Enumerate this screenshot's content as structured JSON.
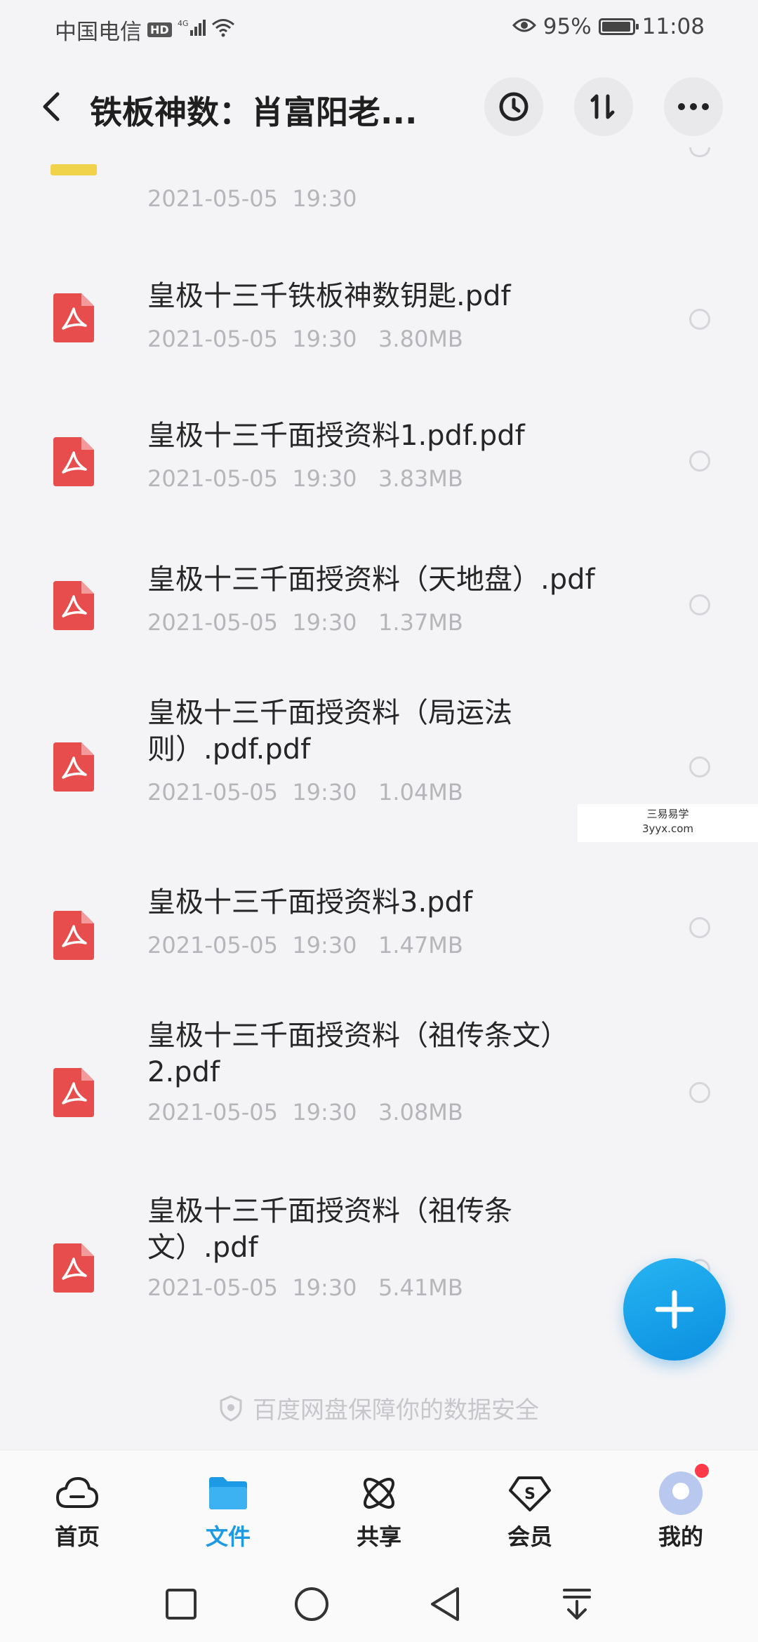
{
  "status_bar": {
    "carrier": "中国电信",
    "hd_badge": "HD",
    "signal": "4G",
    "battery": "95%",
    "battery_level": 0.95,
    "time": "11:08"
  },
  "header": {
    "title": "铁板神数：肖富阳老...",
    "history_icon": "history-icon",
    "sort_icon": "sort-icon",
    "more_icon": "more-icon"
  },
  "files": [
    {
      "name": "",
      "meta": "2021-05-05  19:30",
      "icon": "folder-icon",
      "partial": true
    },
    {
      "name": "皇极十三千铁板神数钥匙.pdf",
      "meta": "2021-05-05  19:30   3.80MB",
      "icon": "pdf-icon"
    },
    {
      "name": "皇极十三千面授资料1.pdf.pdf",
      "meta": "2021-05-05  19:30   3.83MB",
      "icon": "pdf-icon"
    },
    {
      "name": "皇极十三千面授资料（天地盘）.pdf",
      "meta": "2021-05-05  19:30   1.37MB",
      "icon": "pdf-icon"
    },
    {
      "name": "皇极十三千面授资料（局运法则）.pdf.pdf",
      "meta": "2021-05-05  19:30   1.04MB",
      "icon": "pdf-icon"
    },
    {
      "name": "皇极十三千面授资料3.pdf",
      "meta": "2021-05-05  19:30   1.47MB",
      "icon": "pdf-icon"
    },
    {
      "name": "皇极十三千面授资料（祖传条文）2.pdf",
      "meta": "2021-05-05  19:30   3.08MB",
      "icon": "pdf-icon"
    },
    {
      "name": "皇极十三千面授资料（祖传条文）.pdf",
      "meta": "2021-05-05  19:30   5.41MB",
      "icon": "pdf-icon"
    }
  ],
  "safety_note": "百度网盘保障你的数据安全",
  "fab": {
    "icon": "plus-icon"
  },
  "watermark": {
    "line1": "三易易学",
    "line2": "3yyx.com"
  },
  "bottom_nav": [
    {
      "label": "首页",
      "icon": "cloud-home-icon"
    },
    {
      "label": "文件",
      "icon": "folder-icon",
      "active": true
    },
    {
      "label": "共享",
      "icon": "share-icon"
    },
    {
      "label": "会员",
      "icon": "vip-icon"
    },
    {
      "label": "我的",
      "icon": "avatar-icon"
    }
  ],
  "system_nav": [
    "recent-apps-icon",
    "home-icon",
    "back-icon",
    "notification-pull-icon"
  ],
  "colors": {
    "accent": "#1c9ae6",
    "pdf_red": "#e84d4d",
    "fab": "#139ee8",
    "folder_yellow": "#f0d34a"
  }
}
